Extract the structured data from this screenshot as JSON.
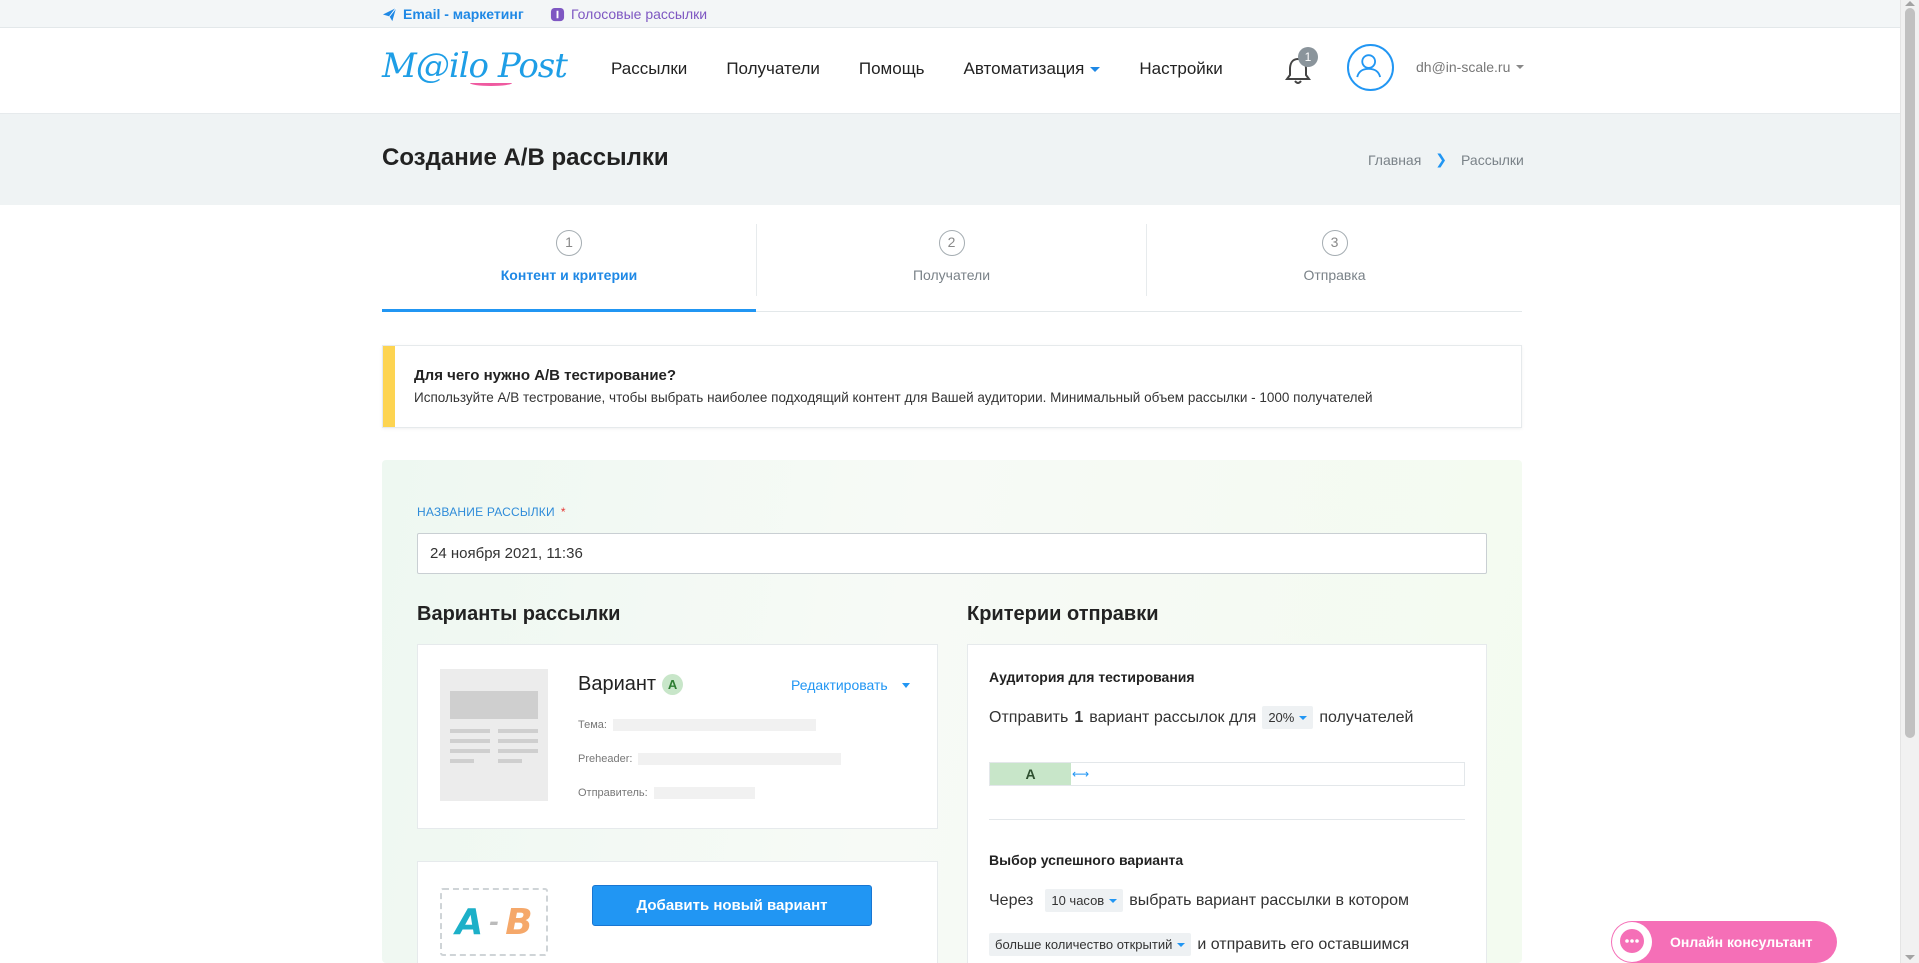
{
  "topbar": {
    "email_link": "Email - маркетинг",
    "voice_link": "Голосовые рассылки"
  },
  "header": {
    "logo": "M@ilo Post",
    "nav": [
      "Рассылки",
      "Получатели",
      "Помощь",
      "Автоматизация",
      "Настройки"
    ],
    "notifications_count": "1",
    "user_email": "dh@in-scale.ru"
  },
  "page": {
    "title": "Создание A/B рассылки",
    "breadcrumbs": [
      "Главная",
      "Рассылки"
    ]
  },
  "steps": [
    {
      "num": "1",
      "label": "Контент и критерии",
      "active": true
    },
    {
      "num": "2",
      "label": "Получатели",
      "active": false
    },
    {
      "num": "3",
      "label": "Отправка",
      "active": false
    }
  ],
  "notice": {
    "title": "Для чего нужно A/B тестирование?",
    "text": "Используйте A/B тестрование, чтобы выбрать наиболее подходящий контент для Вашей аудитории. Минимальный объем рассылки - 1000 получателей"
  },
  "form": {
    "name_label": "НАЗВАНИЕ РАССЫЛКИ",
    "required_mark": "*",
    "name_value": "24 ноября 2021, 11:36"
  },
  "variants": {
    "section_title": "Варианты рассылки",
    "variant_label": "Вариант",
    "variant_letter": "A",
    "edit_label": "Редактировать",
    "subject_label": "Тема:",
    "preheader_label": "Preheader:",
    "sender_label": "Отправитель:",
    "add_button": "Добавить новый вариант",
    "ab_logo_a": "A",
    "ab_logo_dash": "-",
    "ab_logo_b": "B"
  },
  "criteria": {
    "section_title": "Критерии отправки",
    "audience_title": "Аудитория для тестирования",
    "send_prefix": "Отправить",
    "send_count": "1",
    "send_middle": "вариант рассылок для",
    "percent": "20%",
    "send_suffix": "получателей",
    "split_label": "A",
    "split_fraction": 0.17,
    "winner_title": "Выбор успешного варианта",
    "after_prefix": "Через",
    "after_value": "10 часов",
    "after_suffix": "выбрать вариант рассылки в котором",
    "metric_value": "больше количество открытий",
    "metric_suffix": "и отправить его оставшимся"
  },
  "chat": {
    "label": "Онлайн консультант"
  },
  "colors": {
    "accent": "#2196f3",
    "notice_bar": "#fdd451",
    "chat": "#f56fb7",
    "variant_badge": "#c8e6c9"
  }
}
